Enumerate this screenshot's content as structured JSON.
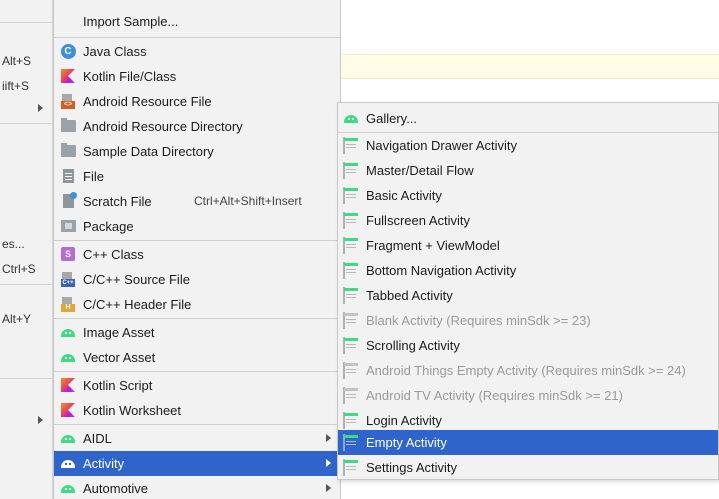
{
  "parent_menu": {
    "items": [
      {
        "text": "Alt+S"
      },
      {
        "text": "iift+S"
      },
      {
        "text": "es..."
      },
      {
        "text": "Ctrl+S"
      },
      {
        "text": "Alt+Y"
      }
    ]
  },
  "new_menu": {
    "items": [
      {
        "label": "Import Sample...",
        "icon": "none",
        "shortcut": ""
      },
      {
        "label": "Java Class",
        "icon": "java-class-icon",
        "shortcut": ""
      },
      {
        "label": "Kotlin File/Class",
        "icon": "kotlin-icon",
        "shortcut": ""
      },
      {
        "label": "Android Resource File",
        "icon": "resource-file-icon",
        "shortcut": ""
      },
      {
        "label": "Android Resource Directory",
        "icon": "folder-icon",
        "shortcut": ""
      },
      {
        "label": "Sample Data Directory",
        "icon": "folder-icon",
        "shortcut": ""
      },
      {
        "label": "File",
        "icon": "file-icon",
        "shortcut": ""
      },
      {
        "label": "Scratch File",
        "icon": "scratch-file-icon",
        "shortcut": "Ctrl+Alt+Shift+Insert"
      },
      {
        "label": "Package",
        "icon": "package-icon",
        "shortcut": ""
      },
      {
        "label": "C++ Class",
        "icon": "cpp-class-icon",
        "shortcut": ""
      },
      {
        "label": "C/C++ Source File",
        "icon": "cpp-source-icon",
        "shortcut": ""
      },
      {
        "label": "C/C++ Header File",
        "icon": "cpp-header-icon",
        "shortcut": ""
      },
      {
        "label": "Image Asset",
        "icon": "android-icon",
        "shortcut": ""
      },
      {
        "label": "Vector Asset",
        "icon": "android-icon",
        "shortcut": ""
      },
      {
        "label": "Kotlin Script",
        "icon": "kotlin-icon",
        "shortcut": ""
      },
      {
        "label": "Kotlin Worksheet",
        "icon": "kotlin-icon",
        "shortcut": ""
      },
      {
        "label": "AIDL",
        "icon": "android-icon",
        "shortcut": ""
      },
      {
        "label": "Activity",
        "icon": "android-icon",
        "shortcut": ""
      },
      {
        "label": "Automotive",
        "icon": "android-icon",
        "shortcut": ""
      }
    ],
    "selected": "Activity"
  },
  "activity_menu": {
    "items": [
      {
        "label": "Gallery...",
        "icon": "android-icon",
        "enabled": true
      },
      {
        "label": "Navigation Drawer Activity",
        "icon": "activity-template-icon",
        "enabled": true
      },
      {
        "label": "Master/Detail Flow",
        "icon": "activity-template-icon",
        "enabled": true
      },
      {
        "label": "Basic Activity",
        "icon": "activity-template-icon",
        "enabled": true
      },
      {
        "label": "Fullscreen Activity",
        "icon": "activity-template-icon",
        "enabled": true
      },
      {
        "label": "Fragment + ViewModel",
        "icon": "activity-template-icon",
        "enabled": true
      },
      {
        "label": "Bottom Navigation Activity",
        "icon": "activity-template-icon",
        "enabled": true
      },
      {
        "label": "Tabbed Activity",
        "icon": "activity-template-icon",
        "enabled": true
      },
      {
        "label": "Blank Activity (Requires minSdk >= 23)",
        "icon": "activity-template-icon",
        "enabled": false
      },
      {
        "label": "Scrolling Activity",
        "icon": "activity-template-icon",
        "enabled": true
      },
      {
        "label": "Android Things Empty Activity (Requires minSdk >= 24)",
        "icon": "activity-template-icon",
        "enabled": false
      },
      {
        "label": "Android TV Activity (Requires minSdk >= 21)",
        "icon": "activity-template-icon",
        "enabled": false
      },
      {
        "label": "Login Activity",
        "icon": "activity-template-icon",
        "enabled": true
      },
      {
        "label": "Empty Activity",
        "icon": "activity-template-icon",
        "enabled": true
      },
      {
        "label": "Settings Activity",
        "icon": "activity-template-icon",
        "enabled": true
      }
    ],
    "selected": "Empty Activity"
  },
  "colors": {
    "selection": "#2f65ca",
    "menu_bg": "#f2f2f2",
    "caret_line": "#fefbe7",
    "android_green": "#3ddc84",
    "disabled_text": "#9a9a9a"
  }
}
